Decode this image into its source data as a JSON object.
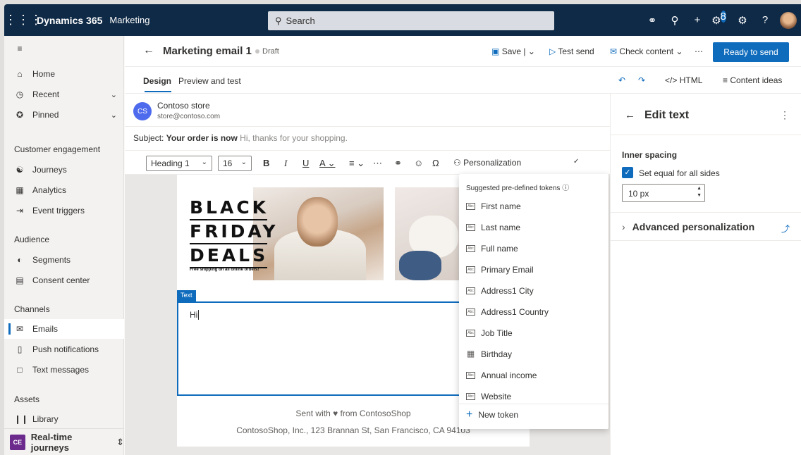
{
  "topbar": {
    "app_name": "Dynamics 365",
    "module": "Marketing",
    "search_placeholder": "Search",
    "notification_count": "8"
  },
  "sidebar": {
    "top_items": [
      {
        "label": "Home",
        "icon": "home-icon"
      },
      {
        "label": "Recent",
        "icon": "clock-icon"
      },
      {
        "label": "Pinned",
        "icon": "pin-icon"
      }
    ],
    "sections": [
      {
        "heading": "Customer engagement",
        "items": [
          {
            "label": "Journeys"
          },
          {
            "label": "Analytics"
          },
          {
            "label": "Event triggers"
          }
        ]
      },
      {
        "heading": "Audience",
        "items": [
          {
            "label": "Segments"
          },
          {
            "label": "Consent center"
          }
        ]
      },
      {
        "heading": "Channels",
        "items": [
          {
            "label": "Emails"
          },
          {
            "label": "Push notifications"
          },
          {
            "label": "Text messages"
          }
        ]
      },
      {
        "heading": "Assets",
        "items": [
          {
            "label": "Library"
          }
        ]
      }
    ],
    "area": {
      "badge": "CE",
      "label": "Real-time journeys"
    }
  },
  "command_bar": {
    "title": "Marketing email 1",
    "status": "Draft",
    "save": "Save",
    "test_send": "Test send",
    "check_content": "Check content",
    "ready": "Ready to send"
  },
  "tabs": {
    "design": "Design",
    "preview": "Preview and test",
    "html": "HTML",
    "content_ideas": "Content ideas"
  },
  "sender": {
    "initials": "CS",
    "name": "Contoso store",
    "email": "store@contoso.com"
  },
  "subject": {
    "label": "Subject:",
    "value": "Your order is now",
    "preheader": "Hi, thanks for your shopping."
  },
  "toolbar": {
    "style": "Heading 1",
    "size": "16",
    "personalization": "Personalization"
  },
  "email_body": {
    "hero_lines": [
      "BLACK",
      "FRIDAY",
      "DEALS"
    ],
    "hero_small": "Free shipping on all online orders!",
    "text_tag": "Text",
    "text": "Hi",
    "footer_line1": "Sent with ♥ from ContosoShop",
    "footer_line2": "ContosoShop, Inc., 123 Brannan St, San Francisco, CA 94103"
  },
  "tokens": {
    "heading": "Suggested pre-defined tokens",
    "items": [
      "First name",
      "Last name",
      "Full name",
      "Primary Email",
      "Address1 City",
      "Address1 Country",
      "Job Title",
      "Birthday",
      "Annual income",
      "Website"
    ],
    "new_token": "New token"
  },
  "panel": {
    "title": "Edit text",
    "inner_spacing_label": "Inner spacing",
    "set_equal_label": "Set equal for all sides",
    "set_equal_checked": true,
    "spacing_value": "10 px",
    "advanced": "Advanced personalization"
  },
  "colors": {
    "topbar": "#0f2a47",
    "accent": "#0f6cbd",
    "area_badge": "#6b2a8c"
  }
}
